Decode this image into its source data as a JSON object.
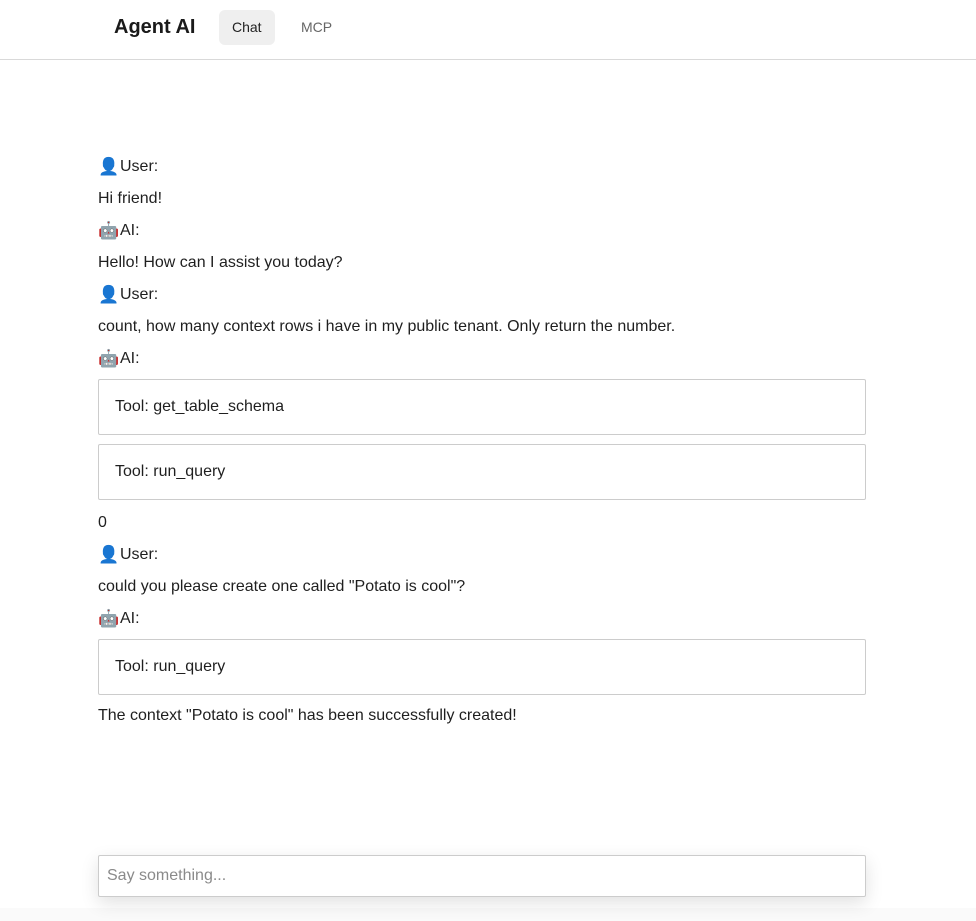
{
  "header": {
    "brand": "Agent AI",
    "tabs": [
      {
        "label": "Chat",
        "active": true
      },
      {
        "label": "MCP",
        "active": false
      }
    ]
  },
  "icons": {
    "user": "user-silhouette-icon",
    "ai": "robot-icon"
  },
  "roles": {
    "user": "User:",
    "ai": "AI:"
  },
  "messages": [
    {
      "role": "user",
      "text": "Hi friend!"
    },
    {
      "role": "ai",
      "text": "Hello! How can I assist you today?"
    },
    {
      "role": "user",
      "text": "count, how many context rows i have in my public tenant. Only return the number."
    },
    {
      "role": "ai",
      "tools": [
        "Tool: get_table_schema",
        "Tool: run_query"
      ],
      "text": "0"
    },
    {
      "role": "user",
      "text": "could you please create one called \"Potato is cool\"?"
    },
    {
      "role": "ai",
      "tools": [
        "Tool: run_query"
      ],
      "text": "The context \"Potato is cool\" has been successfully created!"
    }
  ],
  "composer": {
    "placeholder": "Say something...",
    "value": ""
  }
}
